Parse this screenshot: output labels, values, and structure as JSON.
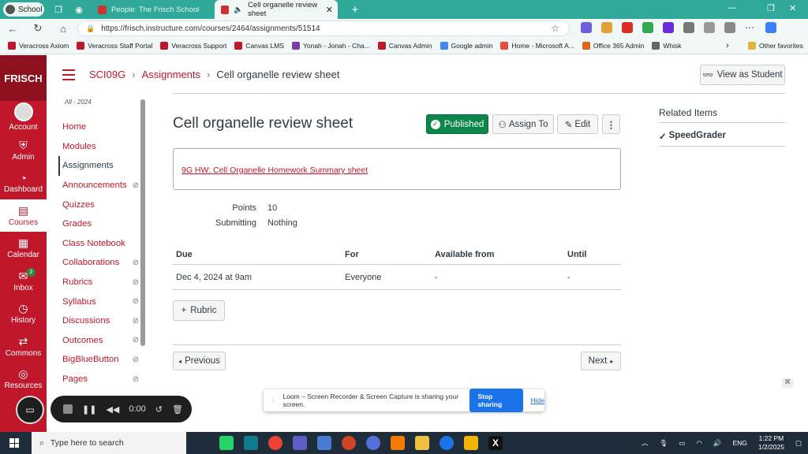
{
  "browser": {
    "profile_label": "School",
    "tabs": [
      {
        "label": "People: The Frisch School"
      },
      {
        "label": "Cell organelle review sheet"
      }
    ],
    "url": "https://frisch.instructure.com/courses/2464/assignments/51514",
    "bookmarks": [
      "Veracross Axiom",
      "Veracross Staff Portal",
      "Veracross Support",
      "Canvas LMS",
      "Yonah - Jonah - Cha...",
      "Canvas Admin",
      "Google admin",
      "Home - Microsoft A...",
      "Office 365 Admin",
      "Whisk"
    ],
    "other_favorites": "Other favorites"
  },
  "global_nav": {
    "logo": "FRISCH",
    "items": [
      {
        "label": "Account"
      },
      {
        "label": "Admin"
      },
      {
        "label": "Dashboard"
      },
      {
        "label": "Courses"
      },
      {
        "label": "Calendar"
      },
      {
        "label": "Inbox"
      },
      {
        "label": "History"
      },
      {
        "label": "Commons"
      },
      {
        "label": "Resources"
      }
    ],
    "inbox_badge": "2"
  },
  "header": {
    "course": "SCI09G",
    "section": "Assignments",
    "current": "Cell organelle review sheet",
    "view_as_student": "View as Student"
  },
  "course_nav": {
    "term": "All - 2024",
    "items": [
      {
        "label": "Home",
        "hidden": false
      },
      {
        "label": "Modules",
        "hidden": false
      },
      {
        "label": "Assignments",
        "hidden": false
      },
      {
        "label": "Announcements",
        "hidden": true
      },
      {
        "label": "Quizzes",
        "hidden": false
      },
      {
        "label": "Grades",
        "hidden": false
      },
      {
        "label": "Class Notebook",
        "hidden": false
      },
      {
        "label": "Collaborations",
        "hidden": true
      },
      {
        "label": "Rubrics",
        "hidden": true
      },
      {
        "label": "Syllabus",
        "hidden": true
      },
      {
        "label": "Discussions",
        "hidden": true
      },
      {
        "label": "Outcomes",
        "hidden": true
      },
      {
        "label": "BigBlueButton",
        "hidden": true
      },
      {
        "label": "Pages",
        "hidden": true
      }
    ]
  },
  "assignment": {
    "title": "Cell organelle review sheet",
    "published_label": "Published",
    "assign_to_label": "Assign To",
    "edit_label": "Edit",
    "more_label": "⋮",
    "description_link": "9G HW: Cell Organelle Homework Summary sheet",
    "points_label": "Points",
    "points_value": "10",
    "submitting_label": "Submitting",
    "submitting_value": "Nothing",
    "table": {
      "headers": [
        "Due",
        "For",
        "Available from",
        "Until"
      ],
      "row": [
        "Dec 4, 2024 at 9am",
        "Everyone",
        "-",
        "-"
      ]
    },
    "rubric_label": "Rubric",
    "previous_label": "Previous",
    "next_label": "Next"
  },
  "sidebar": {
    "related_items": "Related Items",
    "speedgrader": "SpeedGrader"
  },
  "recorder": {
    "time": "0:00"
  },
  "loom": {
    "message": "Loom – Screen Recorder & Screen Capture is sharing your screen.",
    "stop_label": "Stop sharing",
    "hide_label": "Hide"
  },
  "taskbar": {
    "search_placeholder": "Type here to search",
    "lang": "ENG",
    "time": "1:22 PM",
    "date": "1/2/2025"
  }
}
